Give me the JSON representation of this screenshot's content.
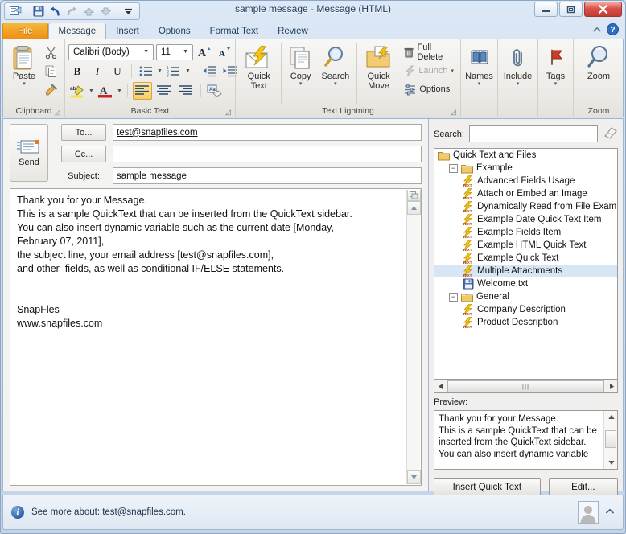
{
  "window": {
    "title": "sample message  -  Message (HTML)",
    "minimize_label": "—",
    "maximize_label": "❐",
    "close_label": "✕"
  },
  "quick_access": {
    "items": [
      {
        "name": "office-logo-icon",
        "label": "✉"
      },
      {
        "name": "save-icon",
        "label": "ὋE"
      },
      {
        "name": "undo-icon",
        "label": "↶"
      },
      {
        "name": "redo-icon",
        "label": "↷"
      },
      {
        "name": "previous-item-icon",
        "label": "▲"
      },
      {
        "name": "next-item-icon",
        "label": "▼"
      },
      {
        "name": "customize-qat-icon",
        "label": "▾"
      }
    ]
  },
  "tabs": [
    {
      "label": "File",
      "type": "file"
    },
    {
      "label": "Message",
      "type": "active"
    },
    {
      "label": "Insert",
      "type": "normal"
    },
    {
      "label": "Options",
      "type": "normal"
    },
    {
      "label": "Format Text",
      "type": "normal"
    },
    {
      "label": "Review",
      "type": "normal"
    }
  ],
  "tab_right": {
    "collapse_ribbon_label": "⌃",
    "help_label": "?"
  },
  "ribbon": {
    "groups": [
      {
        "label": "Clipboard",
        "has_launcher": true
      },
      {
        "label": "Basic Text",
        "has_launcher": true
      },
      {
        "label": "Text Lightning",
        "has_launcher": true
      },
      {
        "label": "",
        "has_launcher": false
      },
      {
        "label": "Zoom",
        "has_launcher": false
      }
    ],
    "clipboard": {
      "paste_label": "Paste",
      "paste_caret": "▾",
      "cut_label": "✂",
      "copy_label": "⧉",
      "format_painter_label": "὘C"
    },
    "basic_text": {
      "font_name": "Calibri (Body)",
      "font_size": "11",
      "grow_font_label": "A",
      "shrink_font_label": "A",
      "bold_label": "B",
      "italic_label": "I",
      "underline_label": "U",
      "bullets_label": "☰",
      "numbering_label": "☰",
      "decrease_indent_label": "⤇",
      "increase_indent_label": "⤅",
      "highlight_label": "ab",
      "font_color_label": "A",
      "align_left_label": "≡",
      "align_center_label": "≡",
      "align_right_label": "≡",
      "clear_formatting_label": "Aa"
    },
    "text_lightning": {
      "quick_text_label": "Quick\nText",
      "copy_label": "Copy",
      "copy_caret": "▾",
      "search_label": "Search",
      "search_caret": "▾",
      "quick_move_label": "Quick\nMove",
      "full_delete_label": "Full Delete",
      "launch_label": "Launch",
      "launch_caret": "▾",
      "options_label": "Options"
    },
    "names_include_tags": [
      {
        "label": "Names",
        "icon": "address-book-icon",
        "caret": "▾"
      },
      {
        "label": "Include",
        "icon": "paperclip-icon",
        "caret": "▾"
      },
      {
        "label": "Tags",
        "icon": "flag-icon",
        "caret": "▾"
      }
    ],
    "zoom": {
      "label": "Zoom",
      "icon": "magnifier-icon"
    }
  },
  "compose": {
    "send_label": "Send",
    "to_label": "To...",
    "to_value": "test@snapfiles.com",
    "cc_label": "Cc...",
    "cc_value": "",
    "subject_label": "Subject:",
    "subject_value": "sample message",
    "body": "Thank you for your Message.\nThis is a sample QuickText that can be inserted from the QuickText sidebar.\nYou can also insert dynamic variable such as the current date [Monday,\nFebruary 07, 2011],\nthe subject line, your email address [test@snapfiles.com],\nand other  fields, as well as conditional IF/ELSE statements.\n\n\nSnapFles\nwww.snapfiles.com",
    "scroll_up_label": "▲",
    "scroll_down_label": "▼",
    "split_button_label": "❐"
  },
  "sidebar": {
    "search_label": "Search:",
    "search_value": "",
    "search_placeholder": "",
    "clear_search_icon": "eraser-icon",
    "tree": [
      {
        "label": "Quick Text and Files",
        "depth": 0,
        "icon": "folder-icon",
        "twisty": "none",
        "selected": false
      },
      {
        "label": "Example",
        "depth": 1,
        "icon": "folder-icon",
        "twisty": "−",
        "selected": false
      },
      {
        "label": "Advanced Fields Usage",
        "depth": 2,
        "icon": "quicktext-icon",
        "twisty": "none",
        "selected": false
      },
      {
        "label": "Attach or Embed an Image",
        "depth": 2,
        "icon": "quicktext-icon",
        "twisty": "none",
        "selected": false
      },
      {
        "label": "Dynamically Read from File Exam",
        "depth": 2,
        "icon": "quicktext-icon",
        "twisty": "none",
        "selected": false
      },
      {
        "label": "Example Date Quick Text Item",
        "depth": 2,
        "icon": "quicktext-icon",
        "twisty": "none",
        "selected": false
      },
      {
        "label": "Example Fields Item",
        "depth": 2,
        "icon": "quicktext-icon",
        "twisty": "none",
        "selected": false
      },
      {
        "label": "Example HTML Quick Text",
        "depth": 2,
        "icon": "quicktext-icon",
        "twisty": "none",
        "selected": false
      },
      {
        "label": "Example Quick Text",
        "depth": 2,
        "icon": "quicktext-icon",
        "twisty": "none",
        "selected": false
      },
      {
        "label": "Multiple Attachments",
        "depth": 2,
        "icon": "quicktext-icon",
        "twisty": "none",
        "selected": true
      },
      {
        "label": "Welcome.txt",
        "depth": 2,
        "icon": "file-icon",
        "twisty": "none",
        "selected": false
      },
      {
        "label": "General",
        "depth": 1,
        "icon": "folder-icon",
        "twisty": "−",
        "selected": false
      },
      {
        "label": "Company Description",
        "depth": 2,
        "icon": "quicktext-icon",
        "twisty": "none",
        "selected": false
      },
      {
        "label": "Product Description",
        "depth": 2,
        "icon": "quicktext-icon",
        "twisty": "none",
        "selected": false
      }
    ],
    "hscroll": {
      "left_label": "◀",
      "right_label": "▶",
      "grip_label": "|||"
    },
    "preview_label": "Preview:",
    "preview_text": "Thank you for your Message.\nThis is a sample QuickText that can be\ninserted from the QuickText sidebar.\nYou can also insert dynamic variable",
    "preview_scroll_up": "▲",
    "preview_scroll_down": "▼",
    "insert_button_label": "Insert Quick Text",
    "edit_button_label": "Edit..."
  },
  "statusbar": {
    "info_icon_label": "i",
    "text": "See more about: test@snapfiles.com.",
    "avatar_name": "contact-avatar",
    "expand_label": "⌃"
  },
  "colors": {
    "accent_orange": "#ef8d16",
    "window_chrome": "#cfdcee",
    "selection_blue": "#d6e6f5",
    "close_red": "#d9524a"
  }
}
